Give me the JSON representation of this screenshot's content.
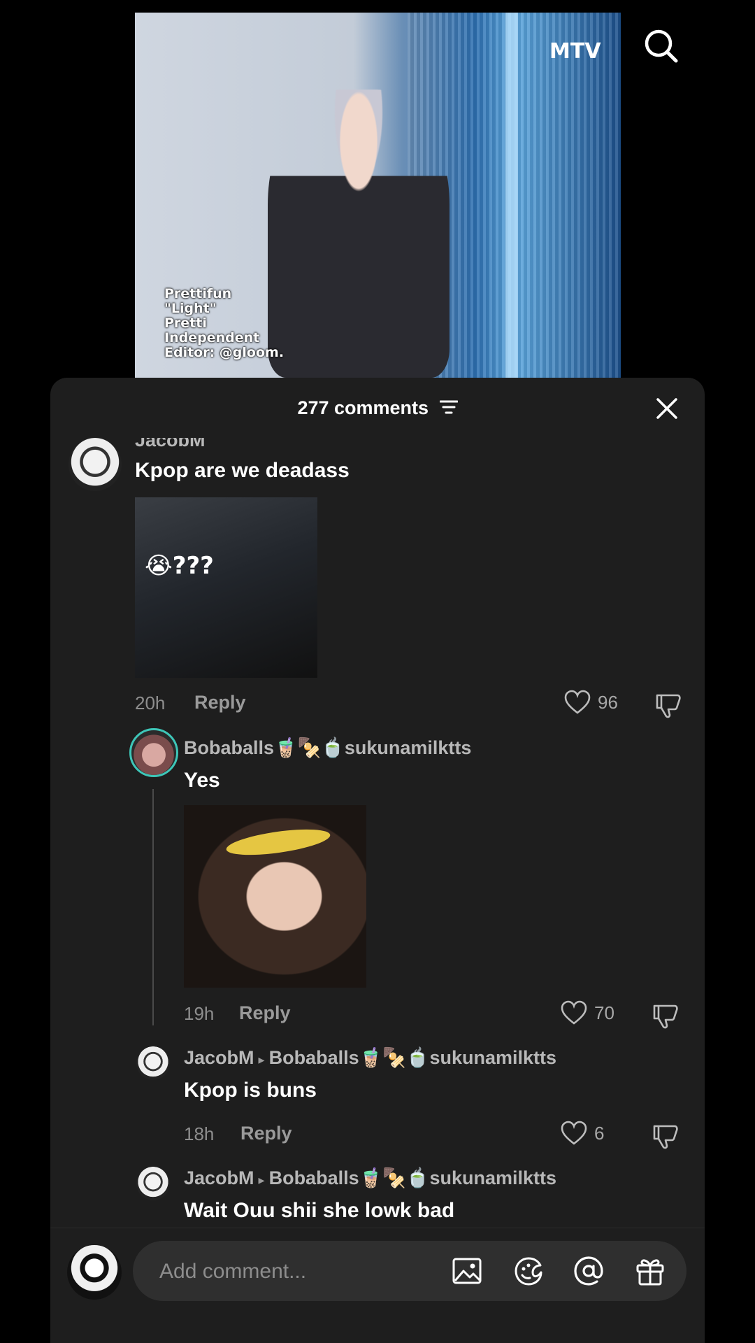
{
  "video": {
    "logo": "MTV",
    "caption": [
      "Prettifun",
      "\"Light\"",
      "Pretti",
      "Independent",
      "Editor: @gloom."
    ]
  },
  "sheet": {
    "title": "277 comments",
    "comments": [
      {
        "username": "JacobM",
        "text": "Kpop are we deadass",
        "image_text": "😭???",
        "time": "20h",
        "reply_label": "Reply",
        "likes": "96"
      },
      {
        "username": "Bobaballs🧋🍢🍵sukunamilktts",
        "text": "Yes",
        "time": "19h",
        "reply_label": "Reply",
        "likes": "70"
      },
      {
        "username": "JacobM",
        "reply_to": "Bobaballs🧋🍢🍵sukunamilktts",
        "text": "Kpop is buns",
        "time": "18h",
        "reply_label": "Reply",
        "likes": "6"
      },
      {
        "username": "JacobM",
        "reply_to": "Bobaballs🧋🍢🍵sukunamilktts",
        "text": "Wait Ouu shii she lowk bad"
      }
    ]
  },
  "composer": {
    "placeholder": "Add comment...",
    "icons": [
      "image-icon",
      "sticker-icon",
      "mention-icon",
      "gift-icon"
    ]
  }
}
